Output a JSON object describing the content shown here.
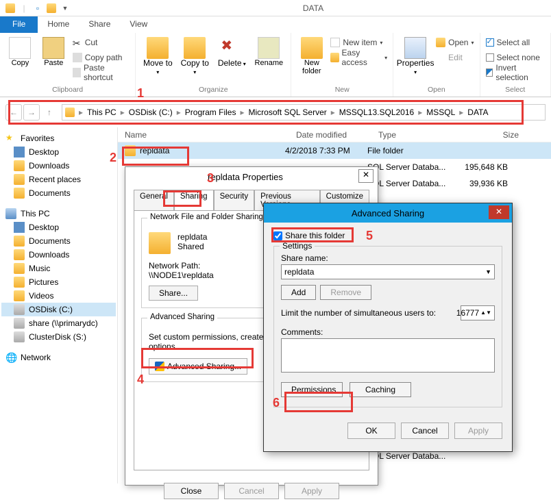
{
  "window": {
    "title": "DATA"
  },
  "ribbon": {
    "file": "File",
    "tabs": [
      "Home",
      "Share",
      "View"
    ],
    "clipboard": {
      "copy": "Copy",
      "paste": "Paste",
      "cut": "Cut",
      "copy_path": "Copy path",
      "paste_shortcut": "Paste shortcut",
      "label": "Clipboard"
    },
    "organize": {
      "move_to": "Move to",
      "copy_to": "Copy to",
      "delete": "Delete",
      "rename": "Rename",
      "label": "Organize"
    },
    "new": {
      "new_folder": "New folder",
      "new_item": "New item",
      "easy_access": "Easy access",
      "label": "New"
    },
    "open": {
      "properties": "Properties",
      "open": "Open",
      "edit": "Edit",
      "label": "Open"
    },
    "select": {
      "select_all": "Select all",
      "select_none": "Select none",
      "invert": "Invert selection",
      "label": "Select"
    }
  },
  "breadcrumb": [
    "This PC",
    "OSDisk (C:)",
    "Program Files",
    "Microsoft SQL Server",
    "MSSQL13.SQL2016",
    "MSSQL",
    "DATA"
  ],
  "nav": {
    "favorites": {
      "label": "Favorites",
      "items": [
        "Desktop",
        "Downloads",
        "Recent places",
        "Documents"
      ]
    },
    "thispc": {
      "label": "This PC",
      "items": [
        "Desktop",
        "Documents",
        "Downloads",
        "Music",
        "Pictures",
        "Videos",
        "OSDisk (C:)",
        "share (\\\\primarydc)",
        "ClusterDisk (S:)"
      ]
    },
    "network": "Network"
  },
  "list": {
    "cols": {
      "name": "Name",
      "date": "Date modified",
      "type": "Type",
      "size": "Size"
    },
    "rows": [
      {
        "name": "repldata",
        "date": "4/2/2018 7:33 PM",
        "type": "File folder",
        "size": ""
      },
      {
        "name": "",
        "date": "",
        "type": "SQL Server Databa...",
        "size": "195,648 KB"
      },
      {
        "name": "",
        "date": "",
        "type": "SQL Server Databa...",
        "size": "39,936 KB"
      },
      {
        "name": "",
        "date": "",
        "type": "SQL Server Databa...",
        "size": ""
      },
      {
        "name": "",
        "date": "",
        "type": "SQL Server Databa...",
        "size": ""
      }
    ]
  },
  "props": {
    "title": "repldata Properties",
    "tabs": [
      "General",
      "Sharing",
      "Security",
      "Previous Versions",
      "Customize"
    ],
    "nfs_title": "Network File and Folder Sharing",
    "folder_name": "repldata",
    "shared_status": "Shared",
    "netpath_label": "Network Path:",
    "netpath": "\\\\NODE1\\repldata",
    "share_btn": "Share...",
    "adv_title": "Advanced Sharing",
    "adv_desc": "Set custom permissions, create mu advanced sharing options.",
    "adv_btn": "Advanced Sharing...",
    "close": "Close",
    "cancel": "Cancel",
    "apply": "Apply"
  },
  "adv": {
    "title": "Advanced Sharing",
    "share_cb": "Share this folder",
    "settings": "Settings",
    "sname_label": "Share name:",
    "sname": "repldata",
    "add": "Add",
    "remove": "Remove",
    "limit_label": "Limit the number of simultaneous users to:",
    "limit_val": "16777",
    "comments_label": "Comments:",
    "permissions": "Permissions",
    "caching": "Caching",
    "ok": "OK",
    "cancel": "Cancel",
    "apply": "Apply"
  },
  "callouts": {
    "c1": "1",
    "c2": "2",
    "c3": "3",
    "c4": "4",
    "c5": "5",
    "c6": "6"
  }
}
